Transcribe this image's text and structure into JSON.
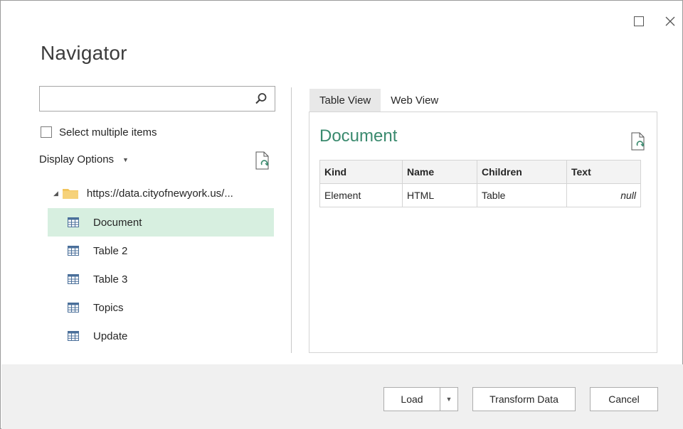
{
  "window": {
    "title": "Navigator",
    "maximize_icon": "maximize-icon",
    "close_icon": "close-icon"
  },
  "left_pane": {
    "search": {
      "placeholder": "",
      "value": "",
      "icon": "search-icon"
    },
    "select_multiple_label": "Select multiple items",
    "select_multiple_checked": false,
    "display_options_label": "Display Options",
    "tree": {
      "root_label": "https://data.cityofnewyork.us/...",
      "items": [
        {
          "label": "Document",
          "selected": true
        },
        {
          "label": "Table 2",
          "selected": false
        },
        {
          "label": "Table 3",
          "selected": false
        },
        {
          "label": "Topics",
          "selected": false
        },
        {
          "label": "Update",
          "selected": false
        }
      ]
    }
  },
  "right_pane": {
    "tabs": [
      {
        "label": "Table View",
        "active": true
      },
      {
        "label": "Web View",
        "active": false
      }
    ],
    "preview_title": "Document",
    "table": {
      "columns": [
        "Kind",
        "Name",
        "Children",
        "Text"
      ],
      "rows": [
        [
          "Element",
          "HTML",
          "Table",
          "null"
        ]
      ]
    }
  },
  "footer": {
    "load_label": "Load",
    "transform_label": "Transform Data",
    "cancel_label": "Cancel"
  },
  "colors": {
    "accent": "#3a8a6e",
    "selected_bg": "#d7efe0",
    "footer_bg": "#f0f0f0"
  }
}
